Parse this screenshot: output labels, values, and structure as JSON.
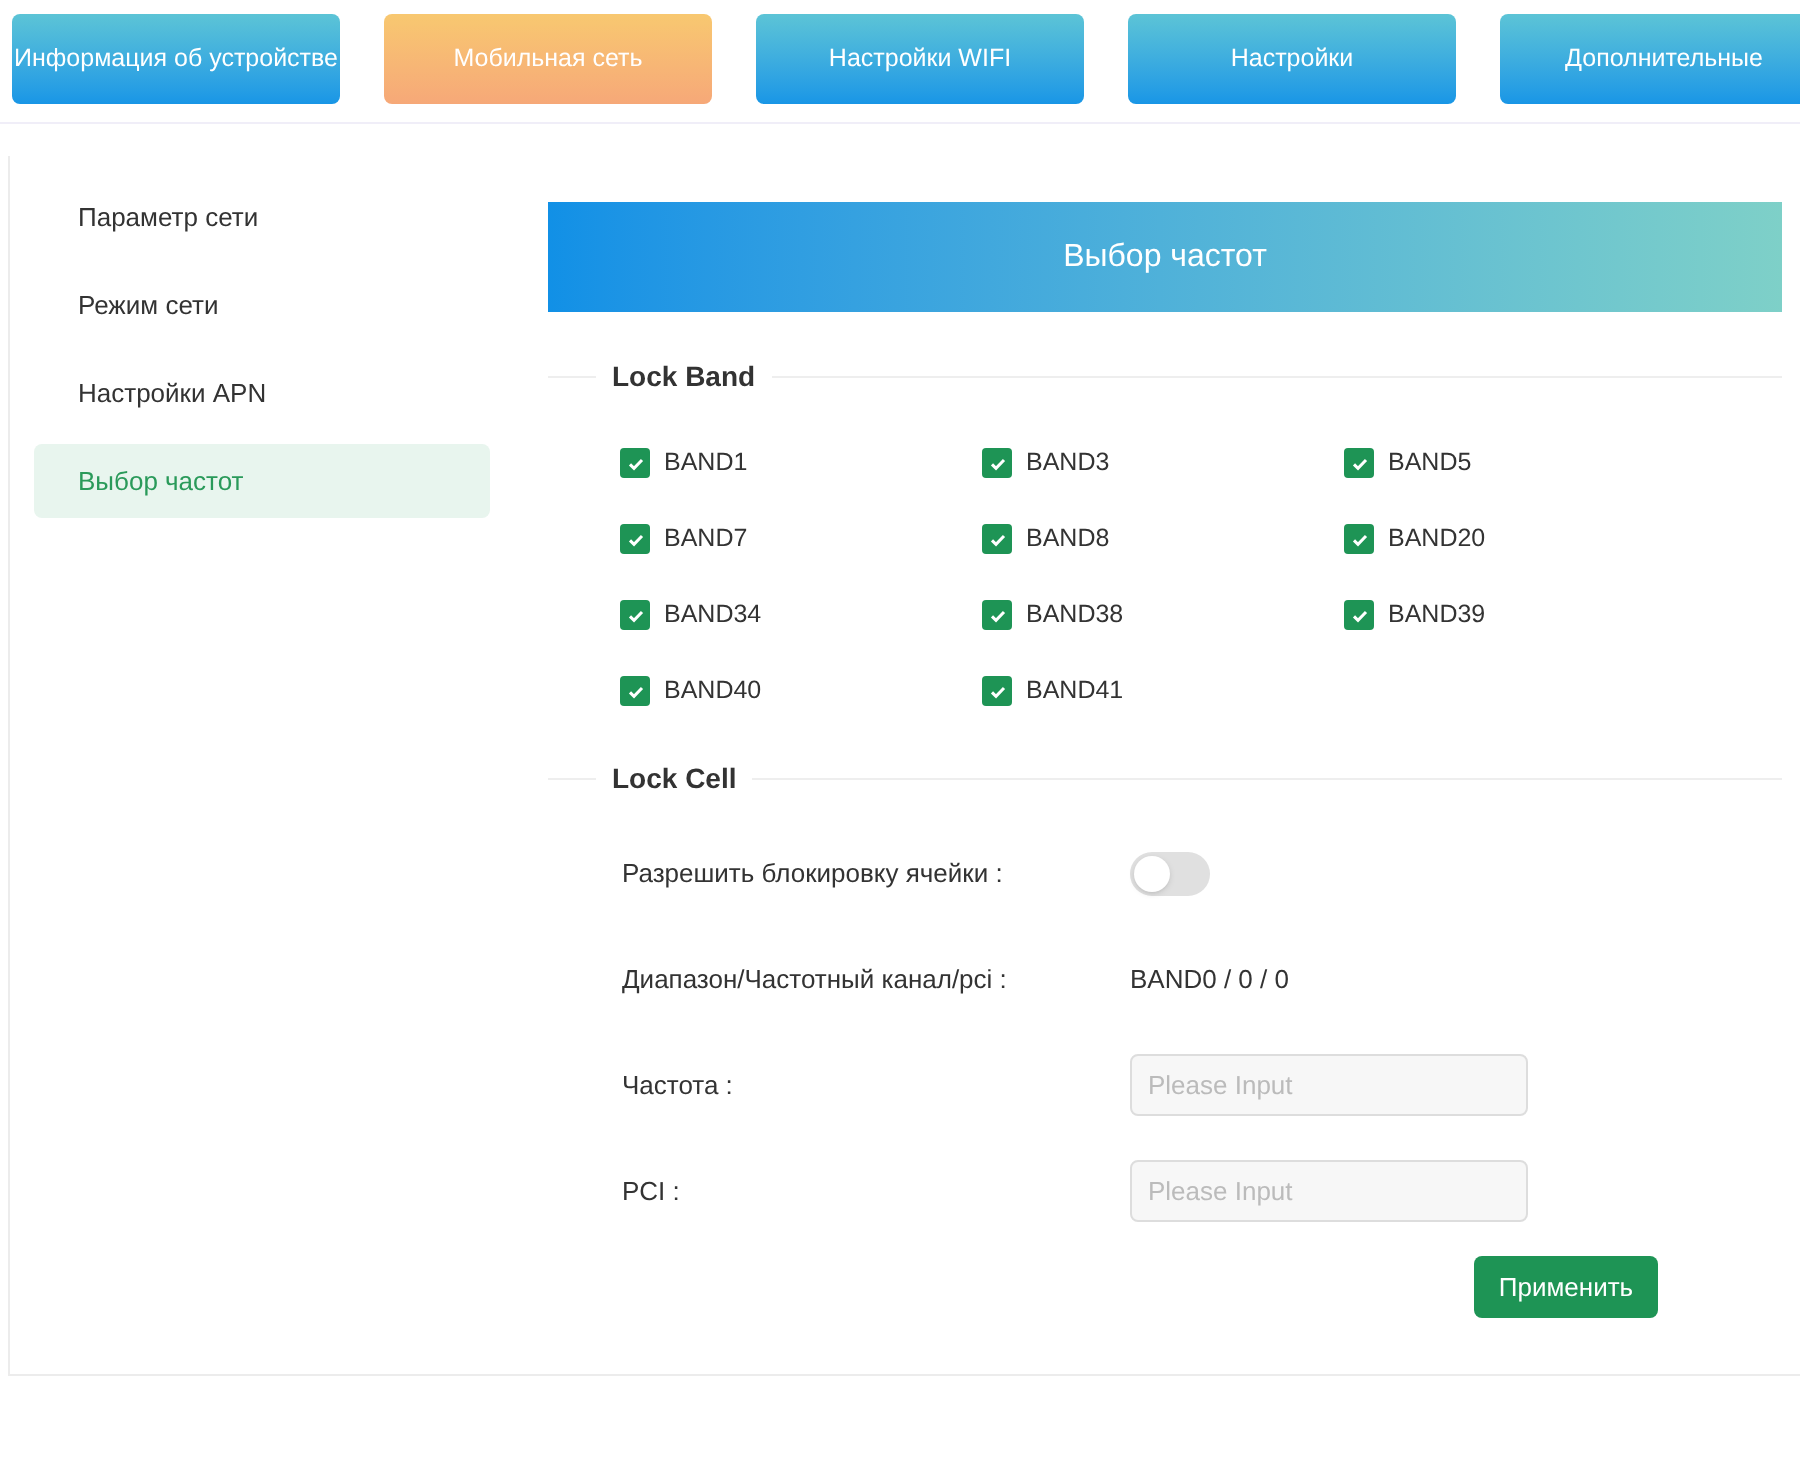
{
  "nav_tabs": [
    {
      "label": "Информация об устройстве",
      "selected": false
    },
    {
      "label": "Мобильная сеть",
      "selected": true
    },
    {
      "label": "Настройки WIFI",
      "selected": false
    },
    {
      "label": "Настройки",
      "selected": false
    },
    {
      "label": "Дополнительные",
      "selected": false
    }
  ],
  "sidebar": {
    "items": [
      {
        "label": "Параметр сети",
        "selected": false
      },
      {
        "label": "Режим сети",
        "selected": false
      },
      {
        "label": "Настройки APN",
        "selected": false
      },
      {
        "label": "Выбор частот",
        "selected": true
      }
    ]
  },
  "page_title": "Выбор частот",
  "lock_band": {
    "title": "Lock Band",
    "bands": [
      {
        "label": "BAND1",
        "checked": true
      },
      {
        "label": "BAND3",
        "checked": true
      },
      {
        "label": "BAND5",
        "checked": true
      },
      {
        "label": "BAND7",
        "checked": true
      },
      {
        "label": "BAND8",
        "checked": true
      },
      {
        "label": "BAND20",
        "checked": true
      },
      {
        "label": "BAND34",
        "checked": true
      },
      {
        "label": "BAND38",
        "checked": true
      },
      {
        "label": "BAND39",
        "checked": true
      },
      {
        "label": "BAND40",
        "checked": true
      },
      {
        "label": "BAND41",
        "checked": true
      }
    ]
  },
  "lock_cell": {
    "title": "Lock Cell",
    "fields": [
      {
        "kind": "switch",
        "label": "Разрешить блокировку ячейки :",
        "on": false
      },
      {
        "kind": "text",
        "label": "Диапазон/Частотный канал/pci :",
        "value": "BAND0 / 0 / 0"
      },
      {
        "kind": "input",
        "label": "Частота :",
        "placeholder": "Please Input"
      },
      {
        "kind": "input",
        "label": "PCI :",
        "placeholder": "Please Input"
      }
    ],
    "apply_button": "Применить"
  }
}
